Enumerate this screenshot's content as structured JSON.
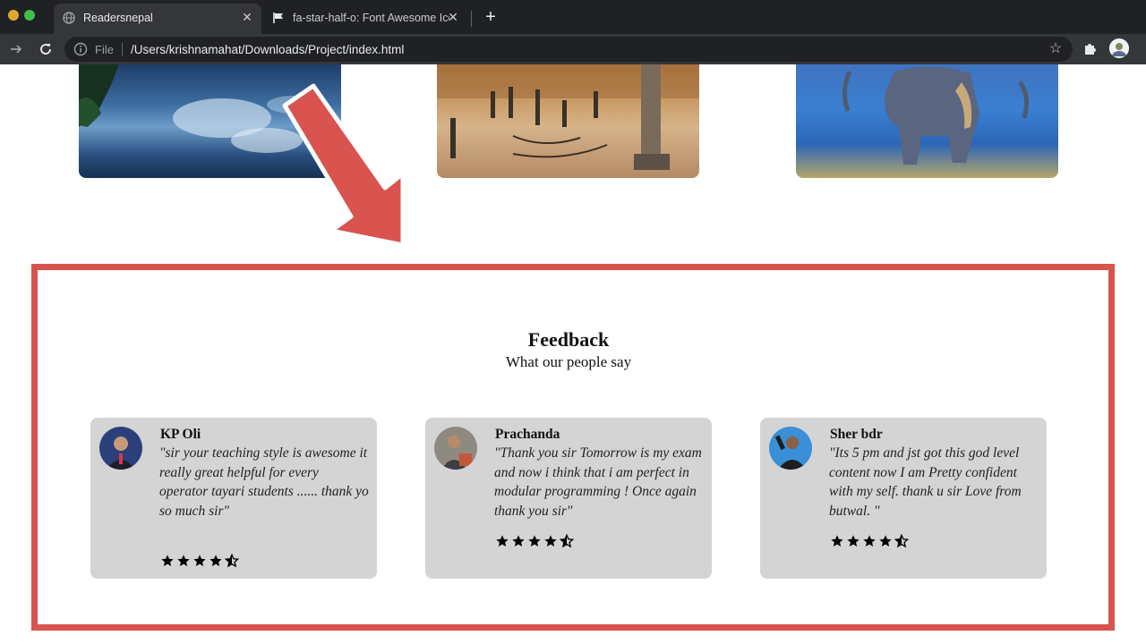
{
  "browser": {
    "tabs": [
      {
        "title": "Readersnepal",
        "icon": "globe-icon",
        "active": true
      },
      {
        "title": "fa-star-half-o: Font Awesome Icons",
        "icon": "flag-icon",
        "active": false
      }
    ],
    "address": {
      "scheme": "File",
      "url": "/Users/krishnamahat/Downloads/Project/index.html"
    }
  },
  "gallery": {
    "images": [
      {
        "name": "lake-photo"
      },
      {
        "name": "durbar-square-photo"
      },
      {
        "name": "elephant-photo"
      }
    ]
  },
  "annotation": {
    "arrow_color": "#d9534f",
    "box_color": "#d9534f"
  },
  "feedback": {
    "title": "Feedback",
    "subtitle": "What our people say",
    "cards": [
      {
        "name": "KP Oli",
        "quote": "\"sir your teaching style is awesome it really great helpful for every operator tayari students ...... thank yo so much sir\"",
        "rating": 4.5
      },
      {
        "name": "Prachanda",
        "quote": "\"Thank you sir Tomorrow is my exam and now i think that i am perfect in modular programming ! Once again thank you sir\"",
        "rating": 4.5
      },
      {
        "name": "Sher bdr",
        "quote": "\"Its 5 pm and jst got this god level content now I am Pretty confident with my self. thank u sir Love from butwal. \"",
        "rating": 4.5
      }
    ]
  }
}
